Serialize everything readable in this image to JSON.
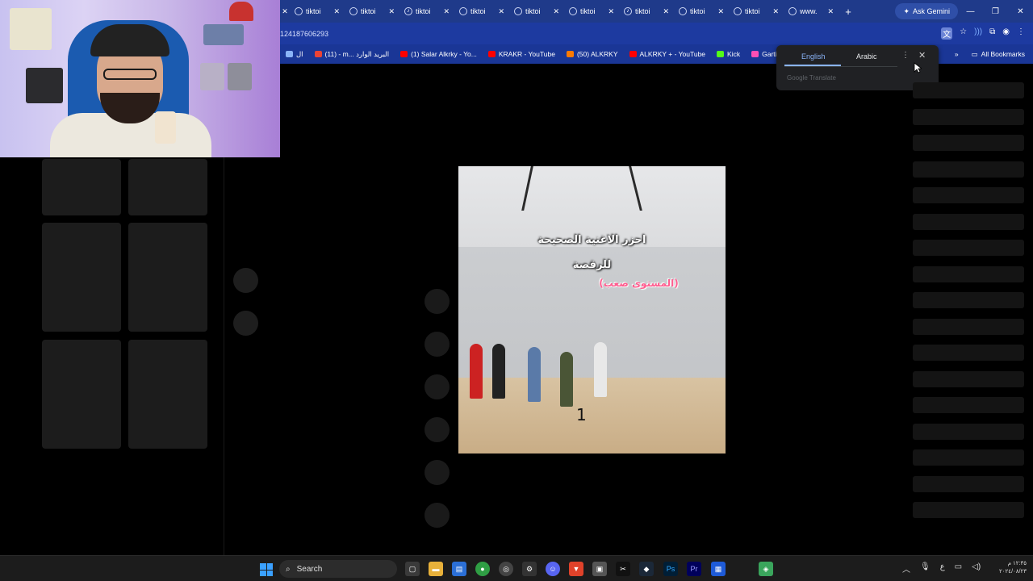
{
  "browser": {
    "tabs": [
      {
        "label": "tiktoi",
        "icon": "globe-icon"
      },
      {
        "label": "tiktoi",
        "icon": "globe-icon"
      },
      {
        "label": "tiktoi",
        "icon": "tiktok-icon"
      },
      {
        "label": "tiktoi",
        "icon": "globe-icon"
      },
      {
        "label": "tiktoi",
        "icon": "globe-icon"
      },
      {
        "label": "tiktoi",
        "icon": "globe-icon"
      },
      {
        "label": "tiktoi",
        "icon": "tiktok-icon"
      },
      {
        "label": "tiktoi",
        "icon": "globe-icon"
      },
      {
        "label": "tiktoi",
        "icon": "globe-icon"
      },
      {
        "label": "www.",
        "icon": "globe-icon"
      }
    ],
    "ask_gemini": "Ask Gemini",
    "url": "124187606293",
    "bookmarks": [
      {
        "label": "ال",
        "color": "#8ab4f8"
      },
      {
        "label": "(11) - m... البريد الوارد",
        "color": "#ea4335"
      },
      {
        "label": "(1) Salar Alkrky - Yo...",
        "color": "#ff0000"
      },
      {
        "label": "KRAKR - YouTube",
        "color": "#ff0000"
      },
      {
        "label": "(50) ALKRKY",
        "color": "#ff7a00"
      },
      {
        "label": "ALKRKY + - YouTube",
        "color": "#ff0000"
      },
      {
        "label": "Kick",
        "color": "#53fc18"
      },
      {
        "label": "Gartic Phone - ...",
        "color": "#ff4fb5"
      }
    ],
    "all_bookmarks": "All Bookmarks"
  },
  "translate": {
    "tab_source": "English",
    "tab_target": "Arabic",
    "brand": "Google Translate"
  },
  "video": {
    "caption_line1": "احزر الاغنية الصحيحة",
    "caption_line2": "للرقصة",
    "caption_line3": "(المستوى صعب)",
    "counter": "1"
  },
  "taskbar": {
    "search_label": "Search",
    "language": "ع",
    "clock_time": "١٢:٣٥ م",
    "clock_date": "٢٠٢٤/٠٨/٢٣"
  }
}
